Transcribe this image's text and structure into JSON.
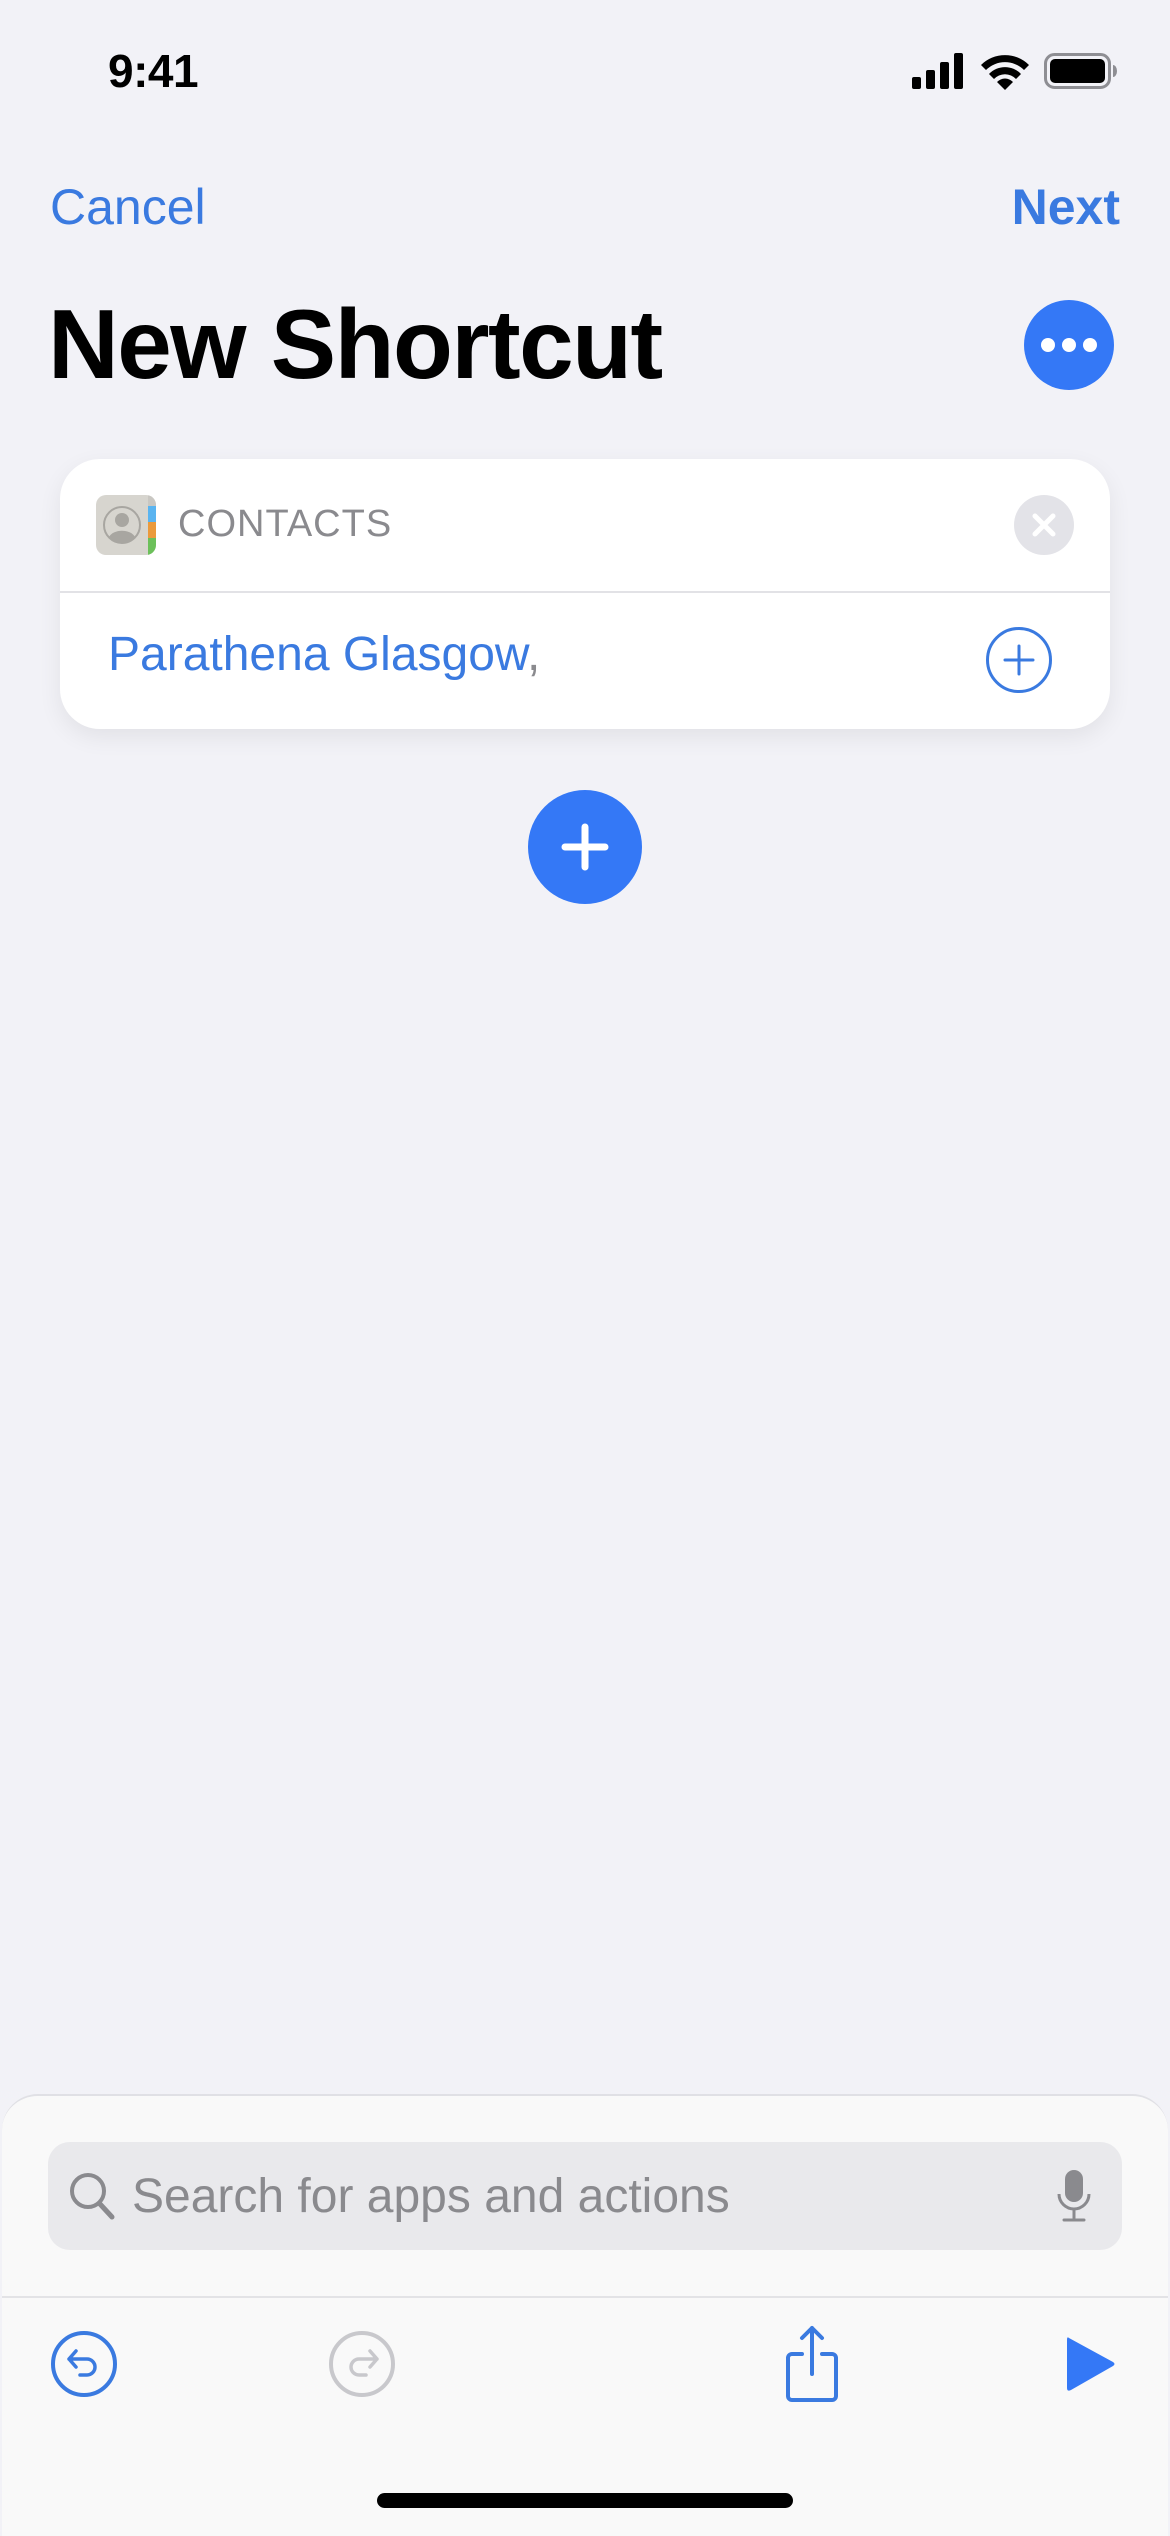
{
  "status_bar": {
    "time": "9:41",
    "signal_bars": 4,
    "wifi": "full",
    "battery_percent": 100
  },
  "nav": {
    "cancel_label": "Cancel",
    "next_label": "Next"
  },
  "header": {
    "title": "New Shortcut",
    "more_icon": "ellipsis-icon"
  },
  "action_card": {
    "app_label": "CONTACTS",
    "app_icon": "contacts-app-icon",
    "value": "Parathena Glasgow",
    "separator": ",",
    "remove_icon": "close-icon",
    "add_icon": "plus-circle-icon"
  },
  "add_action": {
    "icon": "plus-icon"
  },
  "search": {
    "placeholder": "Search for apps and actions",
    "value": ""
  },
  "toolbar": {
    "undo_icon": "undo-icon",
    "redo_icon": "redo-icon",
    "share_icon": "share-icon",
    "run_icon": "play-icon"
  },
  "colors": {
    "accent": "#3478f6",
    "link": "#3a7ae0",
    "background": "#f2f2f7",
    "secondary_text": "#8a8a8e"
  }
}
